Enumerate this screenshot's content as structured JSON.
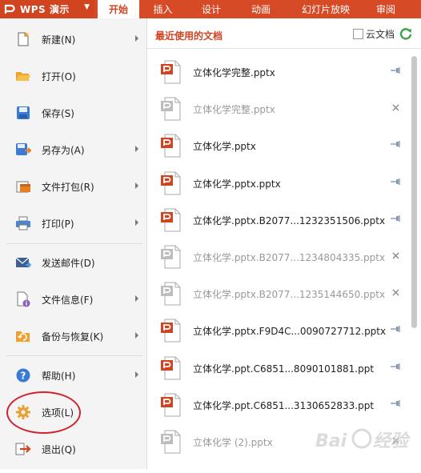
{
  "app": {
    "title": "WPS 演示",
    "dropdown_icon": "chevron-down-icon"
  },
  "tabs": [
    {
      "label": "开始",
      "active": true
    },
    {
      "label": "插入"
    },
    {
      "label": "设计"
    },
    {
      "label": "动画"
    },
    {
      "label": "幻灯片放映"
    },
    {
      "label": "审阅"
    }
  ],
  "menu": [
    {
      "label": "新建(N)",
      "icon": "new-file-icon",
      "submenu": true
    },
    {
      "label": "打开(O)",
      "icon": "folder-open-icon",
      "submenu": false
    },
    {
      "label": "保存(S)",
      "icon": "save-icon",
      "submenu": false
    },
    {
      "label": "另存为(A)",
      "icon": "save-as-icon",
      "submenu": true
    },
    {
      "label": "文件打包(R)",
      "icon": "package-icon",
      "submenu": true
    },
    {
      "label": "打印(P)",
      "icon": "printer-icon",
      "submenu": true
    },
    {
      "label": "发送邮件(D)",
      "icon": "mail-icon",
      "submenu": false
    },
    {
      "label": "文件信息(F)",
      "icon": "file-info-icon",
      "submenu": true
    },
    {
      "label": "备份与恢复(K)",
      "icon": "backup-icon",
      "submenu": true
    },
    {
      "label": "帮助(H)",
      "icon": "help-icon",
      "submenu": true
    },
    {
      "label": "选项(L)",
      "icon": "gear-icon",
      "submenu": false,
      "highlighted": true
    },
    {
      "label": "退出(Q)",
      "icon": "exit-icon",
      "submenu": false
    }
  ],
  "recent": {
    "title": "最近使用的文档",
    "cloud_label": "云文档",
    "cloud_checked": false,
    "files": [
      {
        "name": "立体化学完整.pptx",
        "available": true,
        "action": "pin"
      },
      {
        "name": "立体化学完整.pptx",
        "available": false,
        "action": "remove"
      },
      {
        "name": "立体化学.pptx",
        "available": true,
        "action": "pin"
      },
      {
        "name": "立体化学.pptx.pptx",
        "available": true,
        "action": "pin"
      },
      {
        "name": "立体化学.pptx.B2077...1232351506.pptx",
        "available": true,
        "action": "pin"
      },
      {
        "name": "立体化学.pptx.B2077...1234804335.pptx",
        "available": false,
        "action": "remove"
      },
      {
        "name": "立体化学.pptx.B2077...1235144650.pptx",
        "available": false,
        "action": "remove"
      },
      {
        "name": "立体化学.pptx.F9D4C...0090727712.pptx",
        "available": true,
        "action": "pin"
      },
      {
        "name": "立体化学.ppt.C6851...8090101881.ppt",
        "available": true,
        "action": "pin"
      },
      {
        "name": "立体化学.ppt.C6851...3130652833.ppt",
        "available": true,
        "action": "pin"
      },
      {
        "name": "立体化学 (2).pptx",
        "available": false,
        "action": "remove"
      }
    ]
  },
  "colors": {
    "brand": "#d74a26",
    "accent": "#d14420",
    "sidebar": "#f4f4f4",
    "highlight_ring": "#d0232e"
  }
}
